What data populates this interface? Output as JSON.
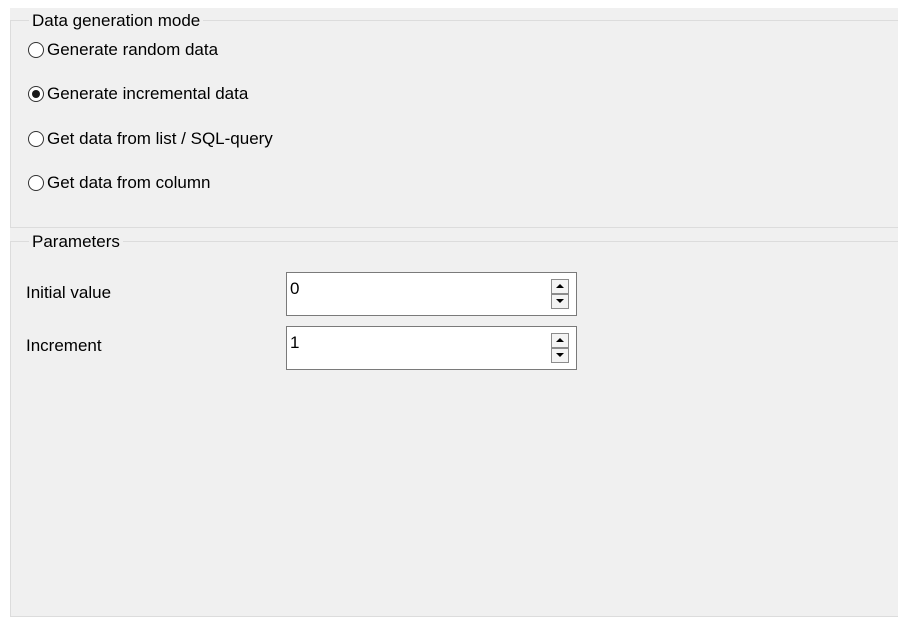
{
  "mode_group": {
    "title": "Data generation mode",
    "options": [
      {
        "label": "Generate random data",
        "checked": false
      },
      {
        "label": "Generate incremental data",
        "checked": true
      },
      {
        "label": "Get data from list / SQL-query",
        "checked": false
      },
      {
        "label": "Get data from column",
        "checked": false
      }
    ]
  },
  "params_group": {
    "title": "Parameters",
    "initial_value": {
      "label": "Initial value",
      "value": "0"
    },
    "increment": {
      "label": "Increment",
      "value": "1"
    }
  },
  "icons": {
    "spin_up": "up-arrow-icon",
    "spin_down": "down-arrow-icon"
  }
}
